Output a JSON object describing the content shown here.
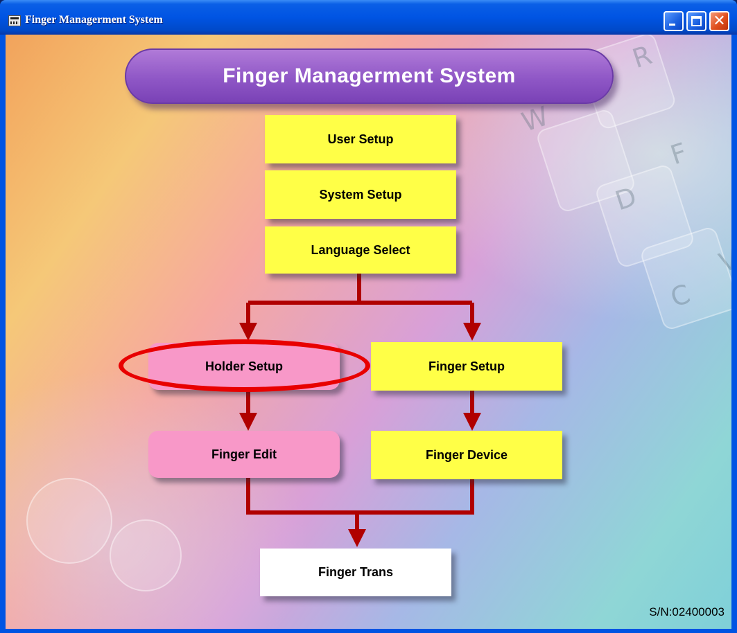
{
  "window": {
    "title": "Finger Managerment System"
  },
  "header": {
    "title": "Finger Managerment System"
  },
  "menu": {
    "user_setup": "User Setup",
    "system_setup": "System Setup",
    "language_select": "Language Select",
    "holder_setup": "Holder Setup",
    "finger_setup": "Finger Setup",
    "finger_edit": "Finger Edit",
    "finger_device": "Finger Device",
    "finger_trans": "Finger Trans"
  },
  "highlighted": "Holder Setup",
  "serial": "S/N:02400003",
  "decor": {
    "key_letters": [
      "R",
      "W",
      "F",
      "D",
      "C",
      "V"
    ]
  },
  "colors": {
    "yellow_button": "#ffff47",
    "pink_button": "#f898c8",
    "header": "#8f57c6",
    "arrow": "#b00000",
    "highlight_ring": "#e80000"
  }
}
